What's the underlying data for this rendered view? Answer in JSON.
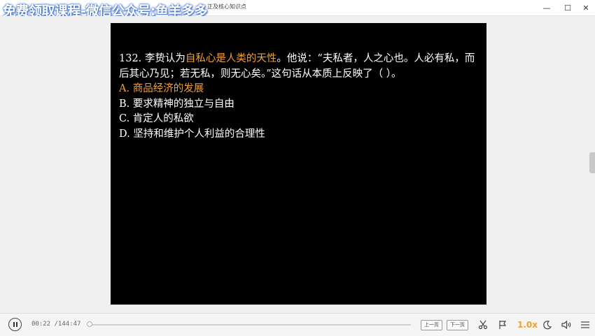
{
  "window": {
    "watermark": "免费领取课程-微信公众号:鱼羊多多",
    "doc_title": "正及核心知识点",
    "controls": {
      "minimize": "—",
      "maximize": "☐",
      "close": "✕"
    }
  },
  "slide": {
    "q_prefix": "132. 李贽认为",
    "q_highlight": "自私心是人类的天性",
    "q_rest": "。他说：“夫私者，人之心也。人必有私，而后其心乃见；若无私，则无心矣。”这句话从本质上反映了（ ）。",
    "options": [
      "A. 商品经济的发展",
      "B. 要求精神的独立与自由",
      "C. 肯定人的私欲",
      "D. 坚持和维护个人利益的合理性"
    ],
    "highlight_color": "#f0a030",
    "background_color": "#000000"
  },
  "player": {
    "current_time": "00:22",
    "total_time": "/144:47",
    "progress": 0.0025,
    "prev_label": "上一页",
    "next_label": "下一页",
    "speed": "1.0x",
    "accent_color": "#f0a030",
    "icons": [
      "pause-icon",
      "scissors-icon",
      "flag-icon",
      "sleep-moon-icon",
      "volume-icon",
      "menu-icon"
    ]
  }
}
